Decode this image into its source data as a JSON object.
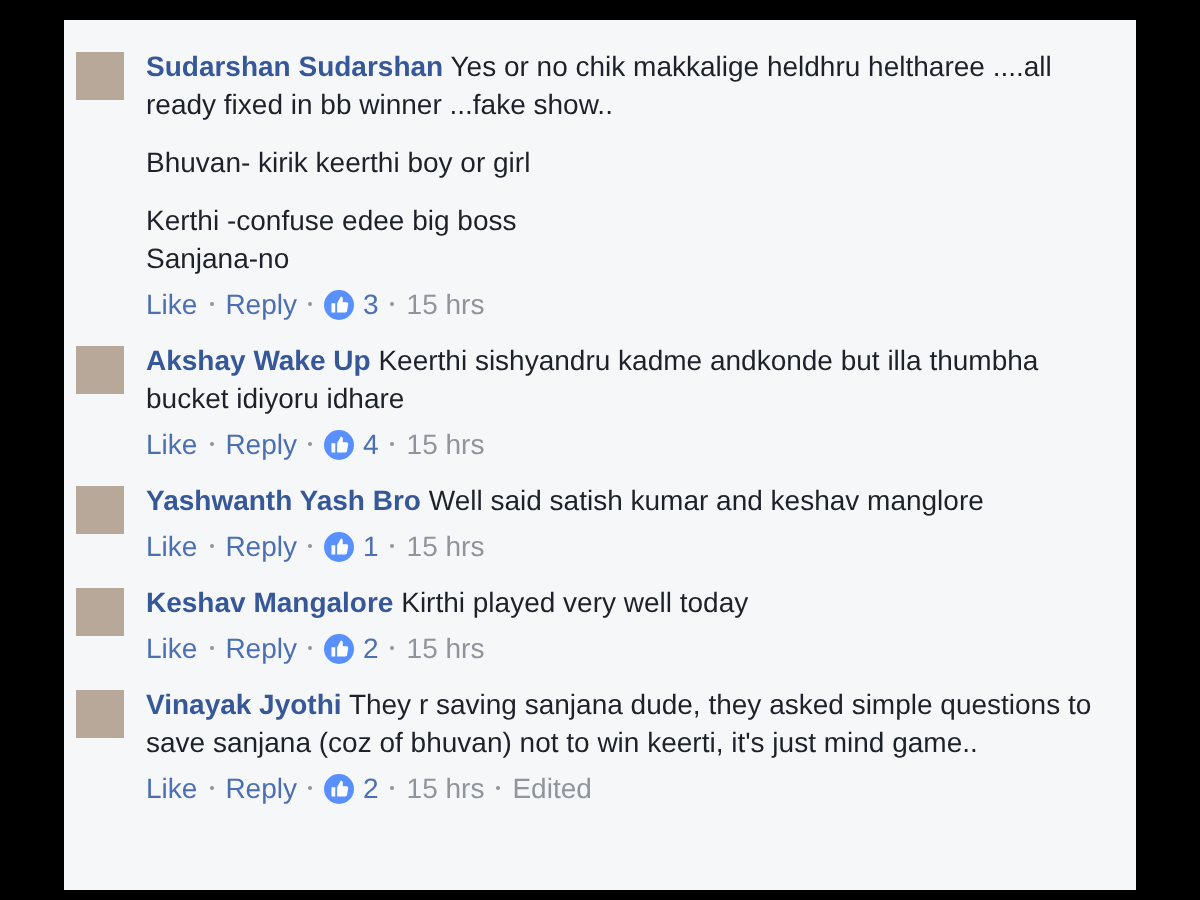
{
  "comments": [
    {
      "author": "Sudarshan Sudarshan",
      "paragraphs": [
        "Yes or no chik makkalige heldhru heltharee ....all ready fixed in bb winner ...fake show..",
        "Bhuvan- kirik keerthi boy or girl",
        "Kerthi -confuse edee big boss\nSanjana-no"
      ],
      "like": "Like",
      "reply": "Reply",
      "likes": "3",
      "time": "15 hrs"
    },
    {
      "author": "Akshay Wake Up",
      "paragraphs": [
        "Keerthi sishyandru kadme andkonde but illa thumbha bucket idiyoru idhare"
      ],
      "like": "Like",
      "reply": "Reply",
      "likes": "4",
      "time": "15 hrs"
    },
    {
      "author": "Yashwanth Yash Bro",
      "paragraphs": [
        "Well said satish kumar and keshav manglore"
      ],
      "like": "Like",
      "reply": "Reply",
      "likes": "1",
      "time": "15 hrs"
    },
    {
      "author": "Keshav Mangalore",
      "paragraphs": [
        "Kirthi played very well today"
      ],
      "like": "Like",
      "reply": "Reply",
      "likes": "2",
      "time": "15 hrs"
    },
    {
      "author": "Vinayak Jyothi",
      "paragraphs": [
        "They r saving sanjana dude, they asked simple questions to save sanjana (coz of bhuvan) not to win keerti, it's just mind game.."
      ],
      "like": "Like",
      "reply": "Reply",
      "likes": "2",
      "time": "15 hrs",
      "edited": "Edited"
    }
  ]
}
